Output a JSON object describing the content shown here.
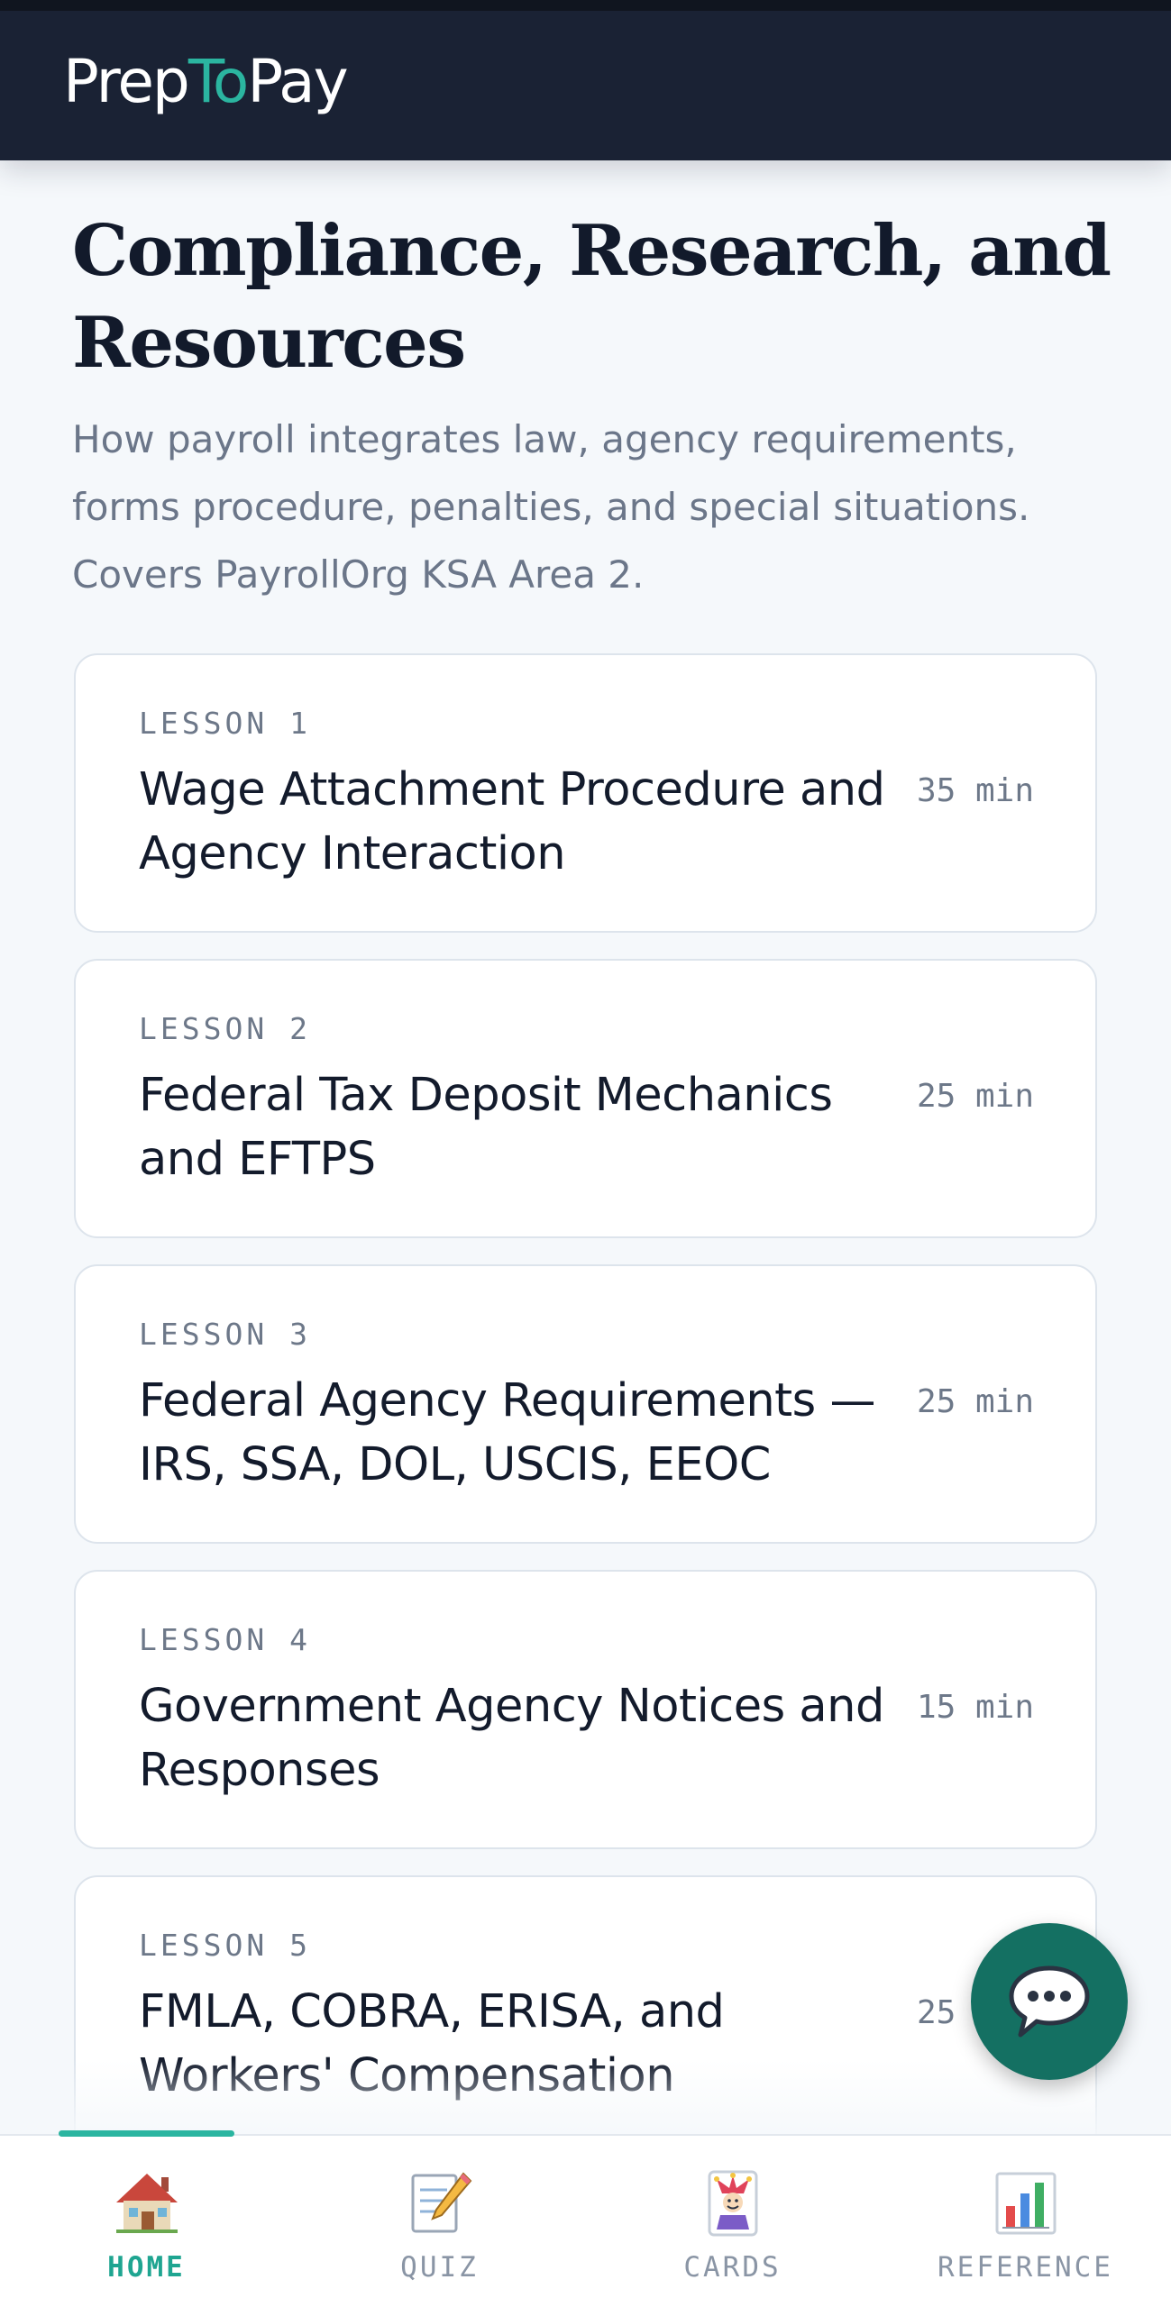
{
  "app": {
    "brand_prefix": "Prep",
    "brand_accent": "To",
    "brand_suffix": "Pay",
    "accent_color": "#2bb5a0",
    "header_color": "#1a2234"
  },
  "page": {
    "title": "Compliance, Research, and Resources",
    "description": "How payroll integrates law, agency requirements, forms procedure, penalties, and special situations. Covers PayrollOrg KSA Area 2."
  },
  "lessons": [
    {
      "label": "LESSON 1",
      "title": "Wage Attachment Procedure and Agency Interaction",
      "duration": "35 min"
    },
    {
      "label": "LESSON 2",
      "title": "Federal Tax Deposit Mechanics and EFTPS",
      "duration": "25 min"
    },
    {
      "label": "LESSON 3",
      "title": "Federal Agency Requirements — IRS, SSA, DOL, USCIS, EEOC",
      "duration": "25 min"
    },
    {
      "label": "LESSON 4",
      "title": "Government Agency Notices and Responses",
      "duration": "15 min"
    },
    {
      "label": "LESSON 5",
      "title": "FMLA, COBRA, ERISA, and Workers' Compensation",
      "duration": "25 min"
    }
  ],
  "chat_button": {
    "icon": "speech-bubble-icon"
  },
  "nav": {
    "items": [
      {
        "label": "HOME",
        "icon": "house-icon",
        "active": true
      },
      {
        "label": "QUIZ",
        "icon": "memo-pencil-icon",
        "active": false
      },
      {
        "label": "CARDS",
        "icon": "joker-card-icon",
        "active": false
      },
      {
        "label": "REFERENCE",
        "icon": "bar-chart-icon",
        "active": false
      }
    ]
  }
}
